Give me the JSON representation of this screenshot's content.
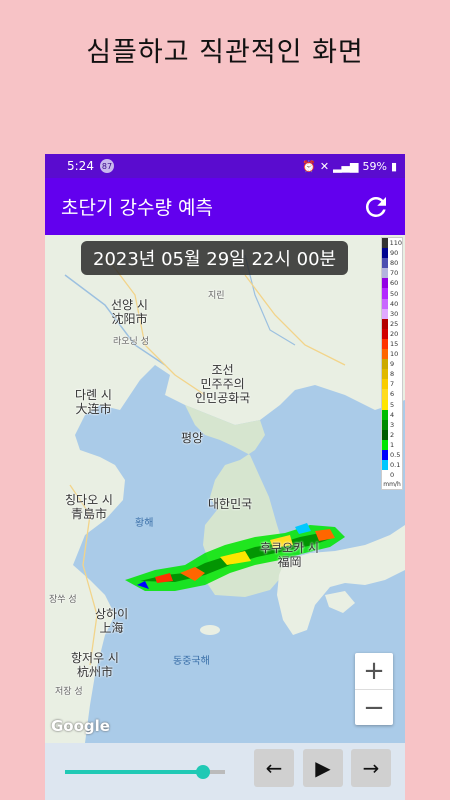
{
  "promo": {
    "caption": "심플하고 직관적인 화면"
  },
  "status_bar": {
    "time": "5:24",
    "notification_count": "87",
    "battery": "59%"
  },
  "app_bar": {
    "title": "초단기 강수량 예측",
    "refresh_icon": "refresh-icon"
  },
  "map": {
    "timestamp": "2023년 05월 29일 22시 00분",
    "attribution": "Google",
    "labels": {
      "shenyang": "선양 시\n沈阳市",
      "jilin": "지린",
      "liaoyang": "라오닝 성",
      "dalian": "다롄 시\n大连市",
      "nk": "조선\n민주주의\n인민공화국",
      "pyongyang": "평양",
      "korea": "대한민국",
      "qingdao": "칭다오 시\n青島市",
      "yellow_sea": "황해",
      "fukuoka": "후쿠오카 시\n福岡",
      "jiangsu": "장쑤 성",
      "shanghai": "상하이\n上海",
      "hangzhou": "항저우 시\n杭州市",
      "zhejiang": "저장 성",
      "east_china_sea": "동중국해"
    },
    "zoom_in": "+",
    "zoom_out": "−"
  },
  "legend": {
    "unit": "mm/h",
    "levels": [
      {
        "label": "110",
        "color": "#333333"
      },
      {
        "label": "90",
        "color": "#000390"
      },
      {
        "label": "80",
        "color": "#4c4eb1"
      },
      {
        "label": "70",
        "color": "#b3b4de"
      },
      {
        "label": "60",
        "color": "#9300e4"
      },
      {
        "label": "50",
        "color": "#b329ff"
      },
      {
        "label": "40",
        "color": "#c969ff"
      },
      {
        "label": "30",
        "color": "#e0a9ff"
      },
      {
        "label": "25",
        "color": "#b40000"
      },
      {
        "label": "20",
        "color": "#d20000"
      },
      {
        "label": "15",
        "color": "#ff3200"
      },
      {
        "label": "10",
        "color": "#ff6600"
      },
      {
        "label": "9",
        "color": "#ccaa00"
      },
      {
        "label": "8",
        "color": "#e0b900"
      },
      {
        "label": "7",
        "color": "#f9cd00"
      },
      {
        "label": "6",
        "color": "#ffdc1f"
      },
      {
        "label": "5",
        "color": "#ffe600"
      },
      {
        "label": "4",
        "color": "#00be00"
      },
      {
        "label": "3",
        "color": "#008c00"
      },
      {
        "label": "2",
        "color": "#005a00"
      },
      {
        "label": "1",
        "color": "#00e600"
      },
      {
        "label": "0.5",
        "color": "#0000ff"
      },
      {
        "label": "0.1",
        "color": "#00c8ff"
      },
      {
        "label": "0",
        "color": "#ffffff"
      }
    ]
  },
  "controls": {
    "slider_progress": 0.86,
    "prev_label": "←",
    "play_label": "▶",
    "next_label": "→"
  },
  "colors": {
    "promo_background": "#f7c3c6",
    "status_bar": "#5a0ccf",
    "app_bar": "#6200ee",
    "slider_accent": "#20c9b5",
    "controls_background": "#dde6f0"
  }
}
